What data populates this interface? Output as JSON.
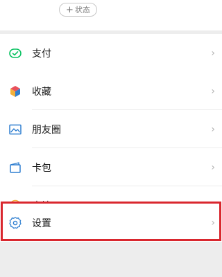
{
  "header": {
    "status_plus": "+",
    "status_label": "状态"
  },
  "menu": {
    "pay": {
      "label": "支付",
      "icon": "wallet-check-icon",
      "color": "#07c160"
    },
    "favorites": {
      "label": "收藏",
      "icon": "cube-icon"
    },
    "moments": {
      "label": "朋友圈",
      "icon": "image-icon",
      "color": "#2f7fd0"
    },
    "cards": {
      "label": "卡包",
      "icon": "card-wallet-icon",
      "color": "#2f7fd0"
    },
    "stickers": {
      "label": "表情",
      "icon": "smiley-icon",
      "color": "#f3b13b"
    },
    "settings": {
      "label": "设置",
      "icon": "gear-icon",
      "color": "#2f7fd0"
    }
  },
  "chevron": "›",
  "highlight_color": "#d9272e"
}
